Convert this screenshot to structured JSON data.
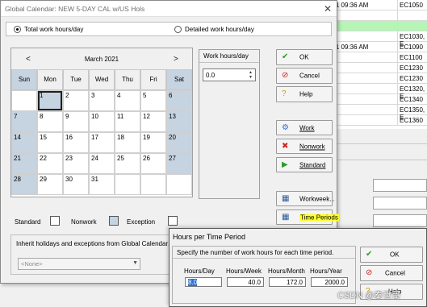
{
  "background_grid": {
    "rows": [
      {
        "date": "11 09:36 AM",
        "code": "EC1050",
        "green": false
      },
      {
        "date": "",
        "code": "",
        "green": false
      },
      {
        "date": "",
        "code": "",
        "green": true
      },
      {
        "date": "",
        "code": "EC1030, E",
        "green": false
      },
      {
        "date": "11 09:36 AM",
        "code": "EC1090",
        "green": false
      },
      {
        "date": "",
        "code": "EC1100",
        "green": false
      },
      {
        "date": "",
        "code": "EC1230",
        "green": false
      },
      {
        "date": "",
        "code": "EC1230",
        "green": false
      },
      {
        "date": "",
        "code": "EC1320, E",
        "green": false
      },
      {
        "date": "",
        "code": "EC1340",
        "green": false
      },
      {
        "date": "",
        "code": "EC1350, E",
        "green": false
      },
      {
        "date": "",
        "code": "EC1360",
        "green": false
      }
    ]
  },
  "calendar_window": {
    "title": "Global Calendar: NEW 5-DAY CAL w/US Hols",
    "close_icon": "close-icon",
    "mode_total": "Total work hours/day",
    "mode_detailed": "Detailed work hours/day",
    "selected_mode": "total",
    "prev_arrow": "<",
    "next_arrow": ">",
    "month": "March 2021",
    "day_headers": [
      "Sun",
      "Mon",
      "Tue",
      "Wed",
      "Thu",
      "Fri",
      "Sat"
    ],
    "weeks": [
      [
        "",
        "1",
        "2",
        "3",
        "4",
        "5",
        "6"
      ],
      [
        "7",
        "8",
        "9",
        "10",
        "11",
        "12",
        "13"
      ],
      [
        "14",
        "15",
        "16",
        "17",
        "18",
        "19",
        "20"
      ],
      [
        "21",
        "22",
        "23",
        "24",
        "25",
        "26",
        "27"
      ],
      [
        "28",
        "29",
        "30",
        "31",
        "",
        "",
        ""
      ]
    ],
    "selected_day": "1",
    "work_hours_header": "Work hours/day",
    "work_hours_value": "0.0",
    "buttons": {
      "ok": "OK",
      "cancel": "Cancel",
      "help": "Help",
      "work": "Work",
      "nonwork": "Nonwork",
      "standard": "Standard",
      "workweek": "Workweek...",
      "time_periods": "Time Periods"
    },
    "legend": {
      "standard": "Standard",
      "nonwork": "Nonwork",
      "exception": "Exception"
    },
    "inherit_label": "Inherit holidays and exceptions from Global Calendar:",
    "inherit_value": "<None>"
  },
  "hours_dialog": {
    "title": "Hours per Time Period",
    "instruction": "Specify the number of work hours for each time period.",
    "labels": {
      "day": "Hours/Day",
      "week": "Hours/Week",
      "month": "Hours/Month",
      "year": "Hours/Year"
    },
    "values": {
      "day": "8.0",
      "week": "40.0",
      "month": "172.0",
      "year": "2000.0"
    },
    "buttons": {
      "ok": "OK",
      "cancel": "Cancel",
      "help": "Help"
    }
  },
  "colors": {
    "weekend": "#c6d3e0",
    "highlight": "#ffff33",
    "selection": "#2a6fd6",
    "green_row": "#b6f5b6"
  },
  "watermark": "CSDN @秦世哥"
}
